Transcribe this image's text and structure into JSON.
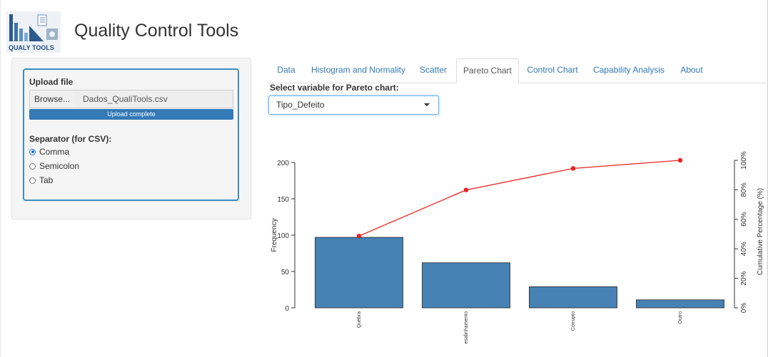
{
  "header": {
    "title": "Quality Control Tools",
    "logo_text": "QUALY TOOLS"
  },
  "sidebar": {
    "upload_label": "Upload file",
    "browse_label": "Browse...",
    "file_name": "Dados_QualiTools.csv",
    "progress_text": "Upload complete",
    "progress": 1.0,
    "separator_label": "Separator (for CSV):",
    "separators": [
      {
        "label": "Comma",
        "checked": true
      },
      {
        "label": "Semicolon",
        "checked": false
      },
      {
        "label": "Tab",
        "checked": false
      }
    ]
  },
  "tabs": [
    {
      "label": "Data",
      "active": false
    },
    {
      "label": "Histogram and Normality",
      "active": false
    },
    {
      "label": "Scatter",
      "active": false
    },
    {
      "label": "Pareto Chart",
      "active": true
    },
    {
      "label": "Control Chart",
      "active": false
    },
    {
      "label": "Capability Analysis",
      "active": false
    },
    {
      "label": "About",
      "active": false
    }
  ],
  "pareto": {
    "select_label": "Select variable for Pareto chart:",
    "selected_variable": "Tipo_Defeito"
  },
  "colors": {
    "bar_fill": "#4682b4",
    "cumulative_line": "#e8231f",
    "accent": "#3c8dbc",
    "progress": "#337ab7"
  },
  "chart_data": {
    "type": "bar",
    "categories": [
      "Quebra",
      "esalinhamento",
      "Corrupto",
      "Outro"
    ],
    "values": [
      97,
      62,
      29,
      11
    ],
    "cumulative_percent": [
      48.7,
      79.9,
      94.5,
      100
    ],
    "ylabel": "Frequency",
    "y2label": "Cumulative Percentage (%)",
    "ylim": [
      0,
      200
    ],
    "yticks": [
      "0",
      "50",
      "100",
      "150",
      "200"
    ],
    "y2ticks": [
      "0%",
      "20%",
      "40%",
      "60%",
      "80%",
      "100%"
    ],
    "y2lim": [
      0,
      100
    ]
  }
}
